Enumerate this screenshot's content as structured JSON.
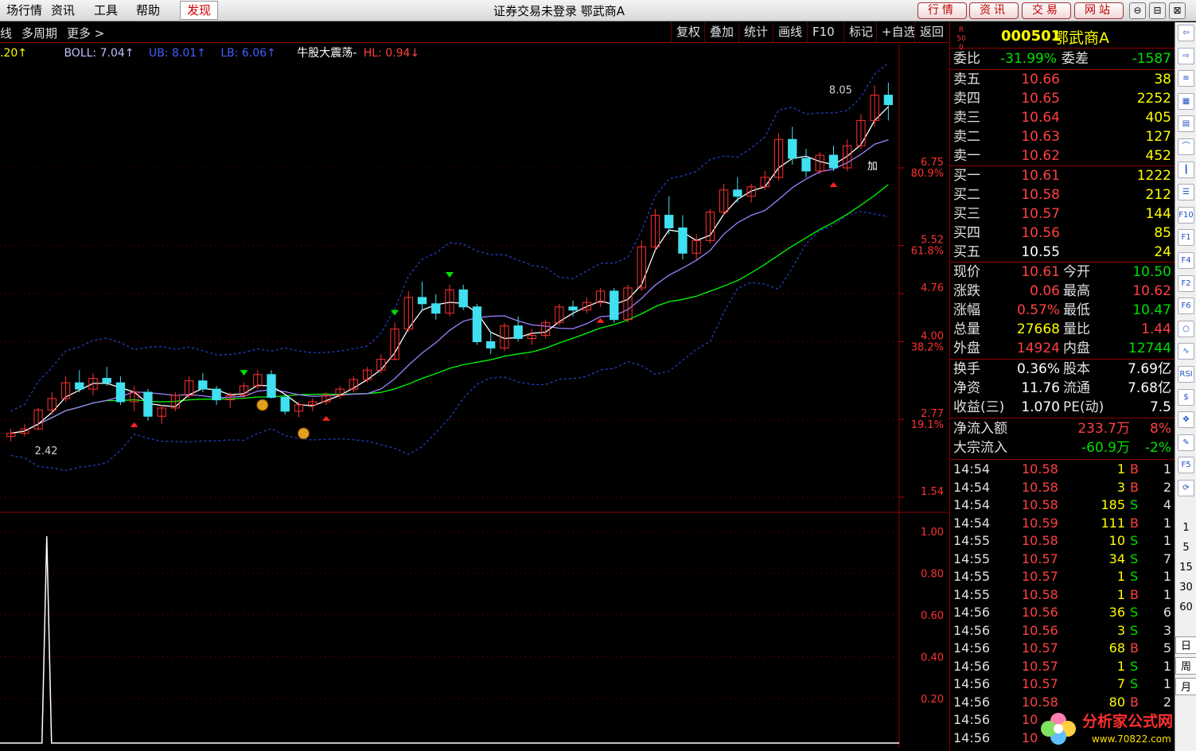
{
  "menus": [
    "场行情",
    "资讯",
    "工具",
    "帮助",
    "发现"
  ],
  "window_title": "证券交易未登录  鄂武商A",
  "top_buttons": [
    "行情",
    "资讯",
    "交易",
    "网站"
  ],
  "window_controls": [
    "⊖",
    "⊟",
    "⊠",
    "✕"
  ],
  "toolbar": {
    "left": [
      "线",
      "多周期",
      "更多 >"
    ],
    "right": [
      "复权",
      "叠加",
      "统计",
      "画线",
      "F10",
      "标记",
      "+自选",
      "返回"
    ]
  },
  "indicators": [
    {
      "text": ".20↑",
      "color": "#ffff00"
    },
    {
      "text": "BOLL: 7.04↑",
      "color": "#c0c0ff"
    },
    {
      "text": "UB: 8.01↑",
      "color": "#4060ff"
    },
    {
      "text": "LB: 6.06↑",
      "color": "#4060ff"
    },
    {
      "text": "牛股大震荡-",
      "color": "#ffffff"
    },
    {
      "text": "HL: 0.94↓",
      "color": "#ff4040"
    }
  ],
  "price_axis": [
    {
      "label": "6.75",
      "pct": "80.9%",
      "v": 6.75
    },
    {
      "label": "5.52",
      "pct": "61.8%",
      "v": 5.52
    },
    {
      "label": "4.76",
      "pct": "",
      "v": 4.76
    },
    {
      "label": "4.00",
      "pct": "38.2%",
      "v": 4.0
    },
    {
      "label": "2.77",
      "pct": "19.1%",
      "v": 2.77
    },
    {
      "label": "1.54",
      "pct": "",
      "v": 1.54
    }
  ],
  "price_annotations": {
    "high": "8.05",
    "low": "2.42",
    "add_label": "加"
  },
  "sub_axis": [
    "1.00",
    "0.80",
    "0.60",
    "0.40",
    "0.20"
  ],
  "stock": {
    "market_badge": "R 500",
    "code": "000501",
    "name": "鄂武商A"
  },
  "order_ratio": {
    "label": "委比",
    "value": "-31.99%",
    "diff_label": "委差",
    "diff": "-1587"
  },
  "asks": [
    {
      "label": "卖五",
      "price": "10.66",
      "vol": "38"
    },
    {
      "label": "卖四",
      "price": "10.65",
      "vol": "2252"
    },
    {
      "label": "卖三",
      "price": "10.64",
      "vol": "405"
    },
    {
      "label": "卖二",
      "price": "10.63",
      "vol": "127"
    },
    {
      "label": "卖一",
      "price": "10.62",
      "vol": "452"
    }
  ],
  "bids": [
    {
      "label": "买一",
      "price": "10.61",
      "vol": "1222"
    },
    {
      "label": "买二",
      "price": "10.58",
      "vol": "212"
    },
    {
      "label": "买三",
      "price": "10.57",
      "vol": "144"
    },
    {
      "label": "买四",
      "price": "10.56",
      "vol": "85"
    },
    {
      "label": "买五",
      "price": "10.55",
      "vol": "24"
    }
  ],
  "quote": [
    {
      "l": "现价",
      "v": "10.61",
      "vc": "red",
      "l2": "今开",
      "v2": "10.50",
      "v2c": "grn"
    },
    {
      "l": "涨跌",
      "v": "0.06",
      "vc": "red",
      "l2": "最高",
      "v2": "10.62",
      "v2c": "red"
    },
    {
      "l": "涨幅",
      "v": "0.57%",
      "vc": "red",
      "l2": "最低",
      "v2": "10.47",
      "v2c": "grn"
    },
    {
      "l": "总量",
      "v": "27668",
      "vc": "yel",
      "l2": "量比",
      "v2": "1.44",
      "v2c": "red"
    },
    {
      "l": "外盘",
      "v": "14924",
      "vc": "red",
      "l2": "内盘",
      "v2": "12744",
      "v2c": "grn"
    }
  ],
  "fundamentals": [
    {
      "l": "换手",
      "v": "0.36%",
      "l2": "股本",
      "v2": "7.69亿"
    },
    {
      "l": "净资",
      "v": "11.76",
      "l2": "流通",
      "v2": "7.68亿"
    },
    {
      "l": "收益(三)",
      "v": "1.070",
      "l2": "PE(动)",
      "v2": "7.5"
    }
  ],
  "flows": [
    {
      "l": "净流入额",
      "v": "233.7万",
      "vc": "red",
      "p": "8%",
      "pc": "red"
    },
    {
      "l": "大宗流入",
      "v": "-60.9万",
      "vc": "grn",
      "p": "-2%",
      "pc": "grn"
    }
  ],
  "ticks": [
    {
      "t": "14:54",
      "p": "10.58",
      "pc": "red",
      "v": "1",
      "s": "B",
      "n": "1"
    },
    {
      "t": "14:54",
      "p": "10.58",
      "pc": "red",
      "v": "3",
      "s": "B",
      "n": "2"
    },
    {
      "t": "14:54",
      "p": "10.58",
      "pc": "red",
      "v": "185",
      "s": "S",
      "n": "4"
    },
    {
      "t": "14:54",
      "p": "10.59",
      "pc": "red",
      "v": "111",
      "s": "B",
      "n": "1"
    },
    {
      "t": "14:55",
      "p": "10.58",
      "pc": "red",
      "v": "10",
      "s": "S",
      "n": "1"
    },
    {
      "t": "14:55",
      "p": "10.57",
      "pc": "red",
      "v": "34",
      "s": "S",
      "n": "7"
    },
    {
      "t": "14:55",
      "p": "10.57",
      "pc": "red",
      "v": "1",
      "s": "S",
      "n": "1"
    },
    {
      "t": "14:55",
      "p": "10.58",
      "pc": "red",
      "v": "1",
      "s": "B",
      "n": "1"
    },
    {
      "t": "14:56",
      "p": "10.56",
      "pc": "red",
      "v": "36",
      "s": "S",
      "n": "6"
    },
    {
      "t": "14:56",
      "p": "10.56",
      "pc": "red",
      "v": "3",
      "s": "S",
      "n": "3"
    },
    {
      "t": "14:56",
      "p": "10.57",
      "pc": "red",
      "v": "68",
      "s": "B",
      "n": "5"
    },
    {
      "t": "14:56",
      "p": "10.57",
      "pc": "red",
      "v": "1",
      "s": "S",
      "n": "1"
    },
    {
      "t": "14:56",
      "p": "10.57",
      "pc": "red",
      "v": "7",
      "s": "S",
      "n": "1"
    },
    {
      "t": "14:56",
      "p": "10.58",
      "pc": "red",
      "v": "80",
      "s": "B",
      "n": "2"
    },
    {
      "t": "14:56",
      "p": "10",
      "pc": "red",
      "v": "",
      "s": "",
      "n": ""
    },
    {
      "t": "14:56",
      "p": "10",
      "pc": "red",
      "v": "",
      "s": "",
      "n": ""
    }
  ],
  "side_toolbar": {
    "icons": [
      "back-arrow-icon",
      "forward-arrow-icon",
      "list-icon",
      "grid-icon",
      "table-icon",
      "line-chart-icon",
      "kline-icon",
      "news-icon",
      "f10-icon",
      "f1-icon",
      "f4-icon",
      "f2-icon",
      "f6-icon",
      "circle-icon",
      "wave-icon",
      "rsi-icon",
      "dollar-icon",
      "move-icon",
      "pencil-icon",
      "f5-icon",
      "refresh-icon"
    ],
    "labels": {
      "rsi": "RSI",
      "f10": "F10",
      "f1": "F1",
      "f2": "F2",
      "f4": "F4",
      "f5": "F5",
      "f6": "F6"
    },
    "periods": [
      "1",
      "5",
      "15",
      "30",
      "60"
    ],
    "bottom": [
      "日",
      "周",
      "月"
    ]
  },
  "watermark": {
    "brand": "分析家公式网",
    "url": "www.70822.com"
  },
  "chart_data": {
    "type": "candlestick",
    "ylim": [
      1.3,
      8.6
    ],
    "candles": [
      [
        2.5,
        2.62,
        2.42,
        2.55
      ],
      [
        2.55,
        2.7,
        2.5,
        2.62
      ],
      [
        2.62,
        2.95,
        2.6,
        2.92
      ],
      [
        2.92,
        3.2,
        2.85,
        3.1
      ],
      [
        3.1,
        3.45,
        3.05,
        3.35
      ],
      [
        3.35,
        3.55,
        3.2,
        3.25
      ],
      [
        3.25,
        3.5,
        3.15,
        3.42
      ],
      [
        3.42,
        3.6,
        3.3,
        3.35
      ],
      [
        3.35,
        3.45,
        3.0,
        3.05
      ],
      [
        3.05,
        3.3,
        2.9,
        3.2
      ],
      [
        3.2,
        3.25,
        2.75,
        2.82
      ],
      [
        2.82,
        3.0,
        2.7,
        2.95
      ],
      [
        2.95,
        3.2,
        2.9,
        3.15
      ],
      [
        3.15,
        3.45,
        3.1,
        3.38
      ],
      [
        3.38,
        3.5,
        3.2,
        3.25
      ],
      [
        3.25,
        3.3,
        3.0,
        3.08
      ],
      [
        3.08,
        3.2,
        2.95,
        3.15
      ],
      [
        3.15,
        3.35,
        3.1,
        3.3
      ],
      [
        3.3,
        3.55,
        3.25,
        3.48
      ],
      [
        3.48,
        3.55,
        3.1,
        3.12
      ],
      [
        3.12,
        3.15,
        2.85,
        2.9
      ],
      [
        2.9,
        3.05,
        2.8,
        3.0
      ],
      [
        3.0,
        3.1,
        2.9,
        3.05
      ],
      [
        3.05,
        3.2,
        3.0,
        3.15
      ],
      [
        3.15,
        3.3,
        3.1,
        3.25
      ],
      [
        3.25,
        3.45,
        3.2,
        3.4
      ],
      [
        3.4,
        3.6,
        3.35,
        3.55
      ],
      [
        3.55,
        3.8,
        3.5,
        3.72
      ],
      [
        3.72,
        4.3,
        3.7,
        4.2
      ],
      [
        4.2,
        4.8,
        4.15,
        4.7
      ],
      [
        4.7,
        4.95,
        4.5,
        4.6
      ],
      [
        4.6,
        4.75,
        4.35,
        4.45
      ],
      [
        4.45,
        4.9,
        4.4,
        4.82
      ],
      [
        4.82,
        4.9,
        4.5,
        4.55
      ],
      [
        4.55,
        4.6,
        3.95,
        4.0
      ],
      [
        4.0,
        4.15,
        3.8,
        3.9
      ],
      [
        3.9,
        4.3,
        3.85,
        4.25
      ],
      [
        4.25,
        4.4,
        4.0,
        4.05
      ],
      [
        4.05,
        4.2,
        3.95,
        4.1
      ],
      [
        4.1,
        4.35,
        4.05,
        4.3
      ],
      [
        4.3,
        4.6,
        4.25,
        4.55
      ],
      [
        4.55,
        4.65,
        4.4,
        4.5
      ],
      [
        4.5,
        4.7,
        4.45,
        4.62
      ],
      [
        4.62,
        4.85,
        4.55,
        4.8
      ],
      [
        4.8,
        4.85,
        4.3,
        4.35
      ],
      [
        4.35,
        4.9,
        4.3,
        4.85
      ],
      [
        4.85,
        5.6,
        4.8,
        5.5
      ],
      [
        5.5,
        6.1,
        5.45,
        6.0
      ],
      [
        6.0,
        6.3,
        5.7,
        5.8
      ],
      [
        5.8,
        6.0,
        5.3,
        5.4
      ],
      [
        5.4,
        5.7,
        5.3,
        5.6
      ],
      [
        5.6,
        6.1,
        5.55,
        6.05
      ],
      [
        6.05,
        6.5,
        6.0,
        6.4
      ],
      [
        6.4,
        6.6,
        6.2,
        6.3
      ],
      [
        6.3,
        6.5,
        6.2,
        6.45
      ],
      [
        6.45,
        6.7,
        6.4,
        6.6
      ],
      [
        6.6,
        7.3,
        6.55,
        7.2
      ],
      [
        7.2,
        7.4,
        6.8,
        6.9
      ],
      [
        6.9,
        7.05,
        6.6,
        6.7
      ],
      [
        6.7,
        7.0,
        6.65,
        6.95
      ],
      [
        6.95,
        7.1,
        6.7,
        6.75
      ],
      [
        6.75,
        7.2,
        6.7,
        7.1
      ],
      [
        7.1,
        7.6,
        7.05,
        7.5
      ],
      [
        7.5,
        8.05,
        7.4,
        7.9
      ],
      [
        7.9,
        8.1,
        7.5,
        7.75
      ]
    ],
    "ma_colors": [
      "#ffffff",
      "#a080ff",
      "#00ff00"
    ],
    "boll_color": "#2040c0",
    "sub_spike": {
      "x_frac": 0.052,
      "value": 1.0
    }
  }
}
